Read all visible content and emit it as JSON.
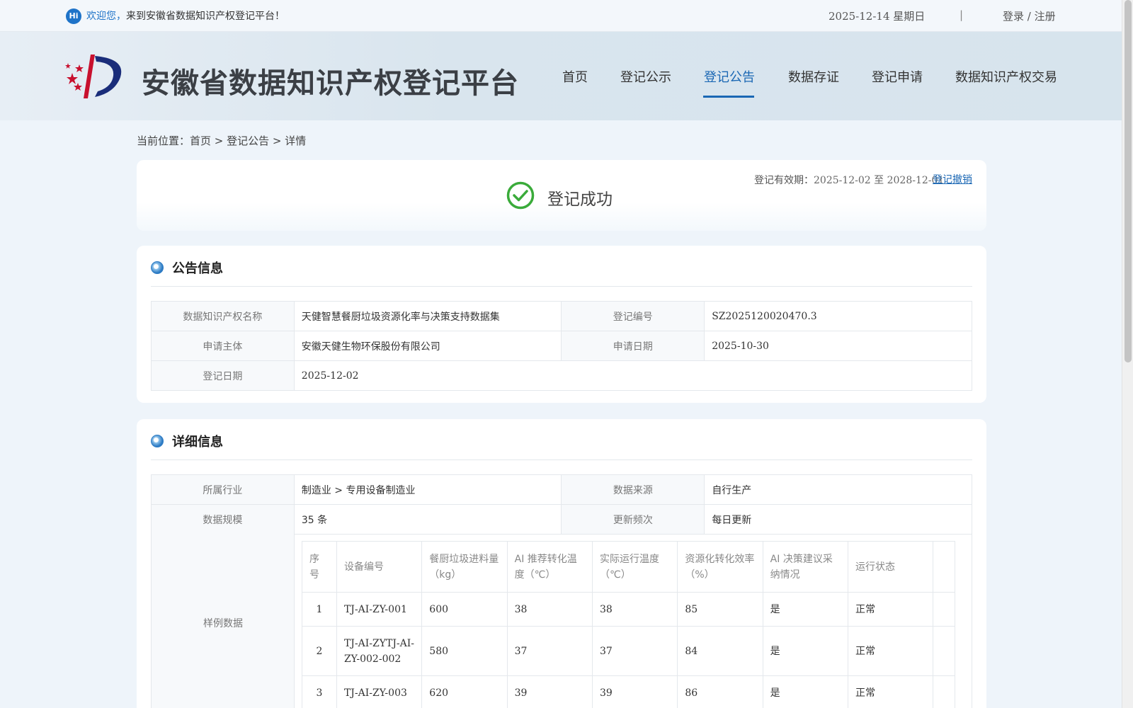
{
  "topbar": {
    "hi": "Hi",
    "welcome_highlight": "欢迎您，",
    "welcome_text": "来到安徽省数据知识产权登记平台！",
    "date": "2025-12-14 星期日",
    "separator": "|",
    "login": "登录 / 注册"
  },
  "header": {
    "site_title": "安徽省数据知识产权登记平台",
    "nav": [
      "首页",
      "登记公示",
      "登记公告",
      "数据存证",
      "登记申请",
      "数据知识产权交易"
    ],
    "active_nav": "登记公告"
  },
  "breadcrumb": "当前位置：首页 > 登记公告 > 详情",
  "status": {
    "text": "登记成功",
    "validity_label": "登记有效期：",
    "validity_value": "2025-12-02 至 2028-12-01",
    "revoke": "登记撤销",
    "color": "#3aab3a"
  },
  "notice": {
    "title": "公告信息",
    "rows": [
      {
        "k1": "数据知识产权名称",
        "v1": "天健智慧餐厨垃圾资源化率与决策支持数据集",
        "k2": "登记编号",
        "v2": "SZ2025120020470.3"
      },
      {
        "k1": "申请主体",
        "v1": "安徽天健生物环保股份有限公司",
        "k2": "申请日期",
        "v2": "2025-10-30"
      },
      {
        "k1": "登记日期",
        "v1": "2025-12-02"
      }
    ]
  },
  "detail": {
    "title": "详细信息",
    "rows": [
      {
        "k1": "所属行业",
        "v1": "制造业 > 专用设备制造业",
        "k2": "数据来源",
        "v2": "自行生产"
      },
      {
        "k1": "数据规模",
        "v1": "35 条",
        "k2": "更新频次",
        "v2": "每日更新"
      }
    ],
    "sample_label": "样例数据",
    "sample": {
      "headers": [
        "序号",
        "设备编号",
        "餐厨垃圾进料量（kg）",
        "AI 推荐转化温度（℃）",
        "实际运行温度（℃）",
        "资源化转化效率（%）",
        "AI 决策建议采纳情况",
        "运行状态"
      ],
      "rows": [
        [
          "1",
          "TJ-AI-ZY-001",
          "600",
          "38",
          "38",
          "85",
          "是",
          "正常"
        ],
        [
          "2",
          "TJ-AI-ZYTJ-AI-ZY-002-002",
          "580",
          "37",
          "37",
          "84",
          "是",
          "正常"
        ],
        [
          "3",
          "TJ-AI-ZY-003",
          "620",
          "39",
          "39",
          "86",
          "是",
          "正常"
        ]
      ]
    }
  },
  "colors": {
    "accent": "#1a67b4",
    "success": "#3aab3a"
  }
}
